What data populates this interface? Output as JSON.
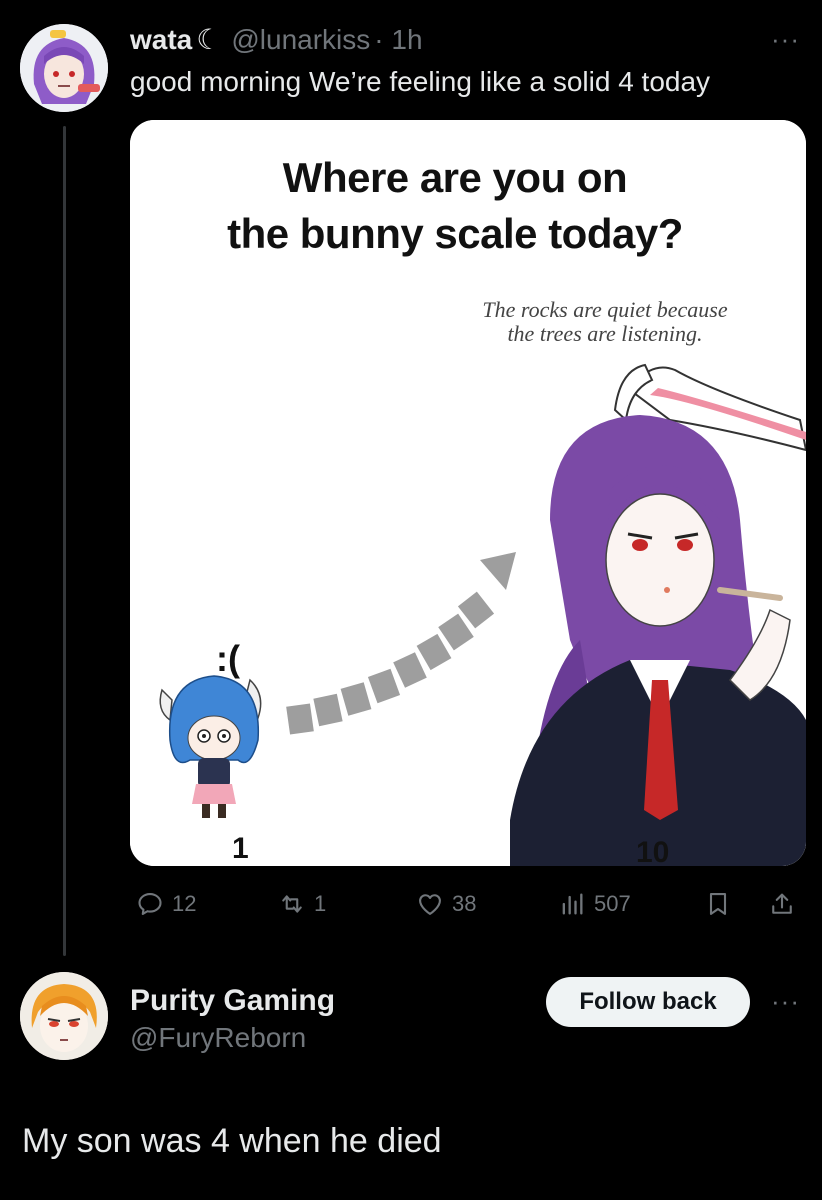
{
  "post": {
    "author": "wata",
    "moon": "☾",
    "handle": "@lunarkiss",
    "time": "· 1h",
    "more": "···",
    "text": "good morning We’re feeling like a solid 4 today",
    "media": {
      "title_line1": "Where are you on",
      "title_line2": "the bunny scale today?",
      "quote_line1": "The rocks are quiet because",
      "quote_line2": "the trees are listening.",
      "sad_face": ":(",
      "scale_low": "1",
      "scale_high": "10"
    },
    "actions": {
      "replies": "12",
      "reposts": "1",
      "likes": "38",
      "views": "507"
    },
    "icons": [
      "reply-icon",
      "repost-icon",
      "like-icon",
      "views-icon",
      "bookmark-icon",
      "share-icon"
    ]
  },
  "reply": {
    "author": "Purity Gaming",
    "handle": "@FuryReborn",
    "follow_label": "Follow back",
    "more": "···",
    "text": "My son was 4 when he died"
  },
  "colors": {
    "background": "#000000",
    "text": "#e7e9ea",
    "muted": "#71767b",
    "button_bg": "#eff3f4"
  }
}
